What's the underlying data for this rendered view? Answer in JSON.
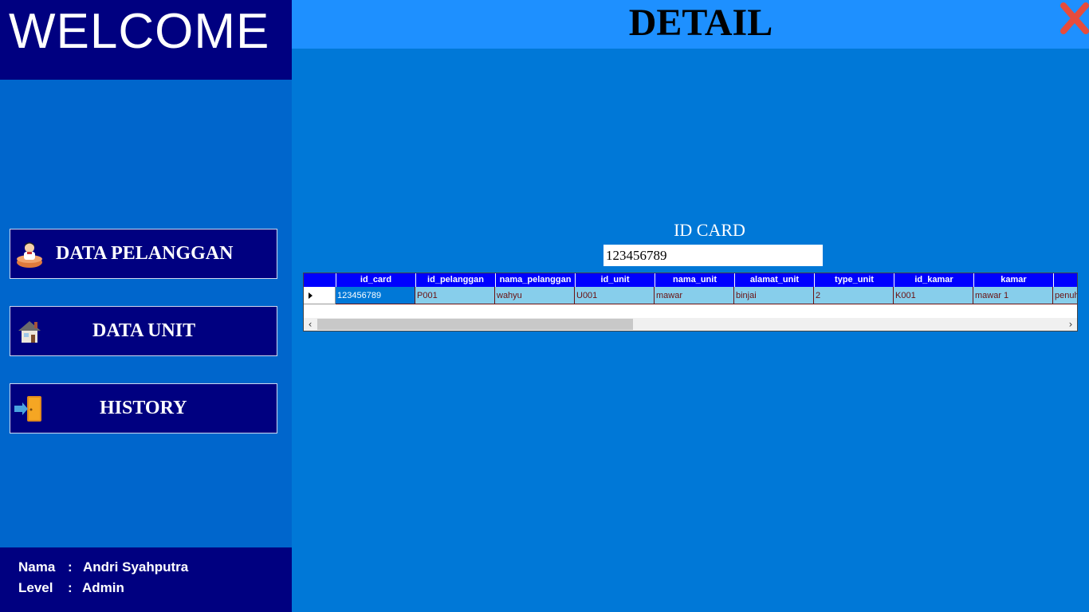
{
  "sidebar": {
    "welcome": "WELCOME",
    "nav": [
      {
        "label": "DATA PELANGGAN",
        "icon": "customer-icon"
      },
      {
        "label": "DATA UNIT",
        "icon": "house-icon"
      },
      {
        "label": "HISTORY",
        "icon": "door-exit-icon"
      }
    ],
    "user": {
      "nama_label": "Nama",
      "nama_value": "Andri Syahputra",
      "level_label": "Level",
      "level_value": "Admin",
      "separator": ":"
    }
  },
  "header": {
    "title": "DETAIL",
    "close_icon": "close-x-icon"
  },
  "search": {
    "label": "ID CARD",
    "value": "123456789"
  },
  "grid": {
    "columns": [
      "id_card",
      "id_pelanggan",
      "nama_pelanggan",
      "id_unit",
      "nama_unit",
      "alamat_unit",
      "type_unit",
      "id_kamar",
      "kamar"
    ],
    "rows": [
      [
        "123456789",
        "P001",
        "wahyu",
        "U001",
        "mawar",
        "binjai",
        "2",
        "K001",
        "mawar 1",
        "penuh"
      ]
    ]
  },
  "colors": {
    "sidebar_bg": "#0066cc",
    "navy": "#000080",
    "header_bg": "#1e90ff",
    "main_bg": "#0078d7",
    "grid_header": "#0000ff",
    "grid_row": "#87ceeb",
    "close": "#e74c3c"
  }
}
